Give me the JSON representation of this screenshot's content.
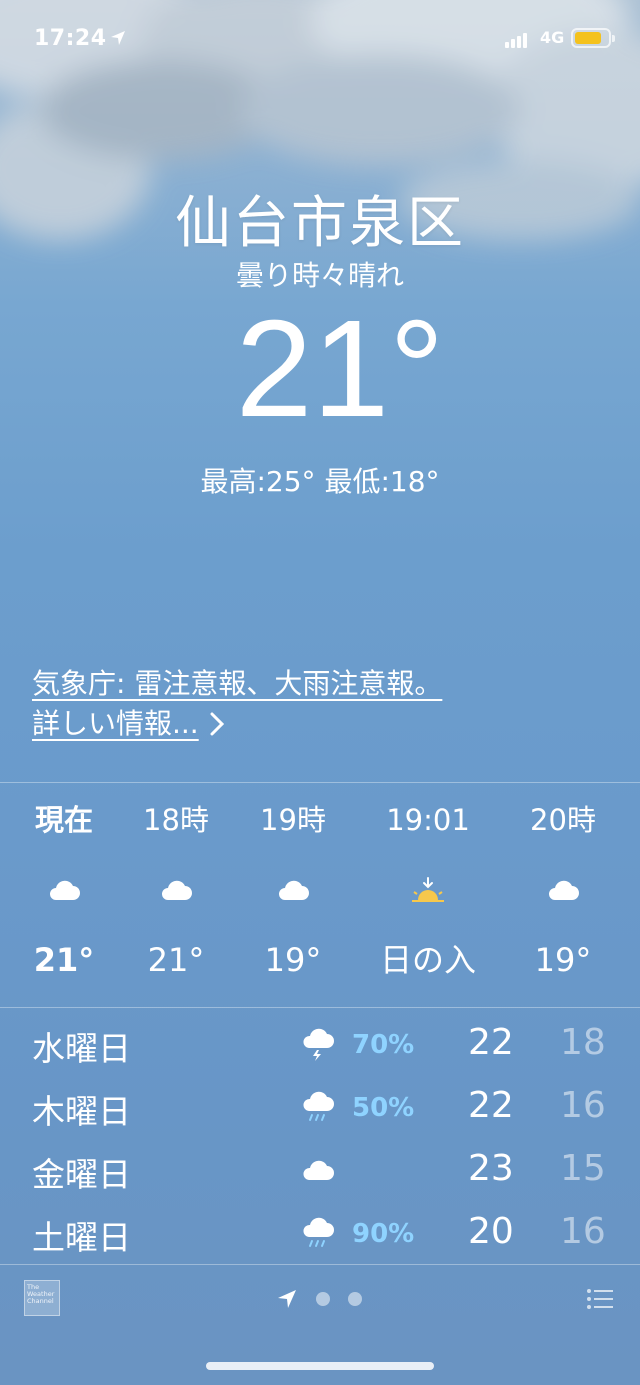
{
  "status_bar": {
    "time": "17:24",
    "network": "4G",
    "battery_color": "#f4c21d"
  },
  "header": {
    "city": "仙台市泉区",
    "condition": "曇り時々晴れ",
    "temperature": "21°",
    "high_low": "最高:25° 最低:18°"
  },
  "alert": {
    "text": "気象庁: 雷注意報、大雨注意報。",
    "more_label": "詳しい情報...",
    "chevron": ">"
  },
  "hourly": [
    {
      "label": "現在",
      "icon": "cloud-icon",
      "temp": "21°"
    },
    {
      "label": "18時",
      "icon": "cloud-icon",
      "temp": "21°"
    },
    {
      "label": "19時",
      "icon": "cloud-icon",
      "temp": "19°"
    },
    {
      "label": "19:01",
      "icon": "sunset-icon",
      "temp": "日の入"
    },
    {
      "label": "20時",
      "icon": "cloud-icon",
      "temp": "19°"
    }
  ],
  "daily": [
    {
      "day": "水曜日",
      "icon": "thunderstorm-icon",
      "pop": "70%",
      "high": "22",
      "low": "18"
    },
    {
      "day": "木曜日",
      "icon": "rain-icon",
      "pop": "50%",
      "high": "22",
      "low": "16"
    },
    {
      "day": "金曜日",
      "icon": "cloud-icon",
      "pop": "",
      "high": "23",
      "low": "15"
    },
    {
      "day": "土曜日",
      "icon": "rain-icon",
      "pop": "90%",
      "high": "20",
      "low": "16"
    }
  ],
  "footer": {
    "provider_logo_text": "The Weather Channel"
  }
}
